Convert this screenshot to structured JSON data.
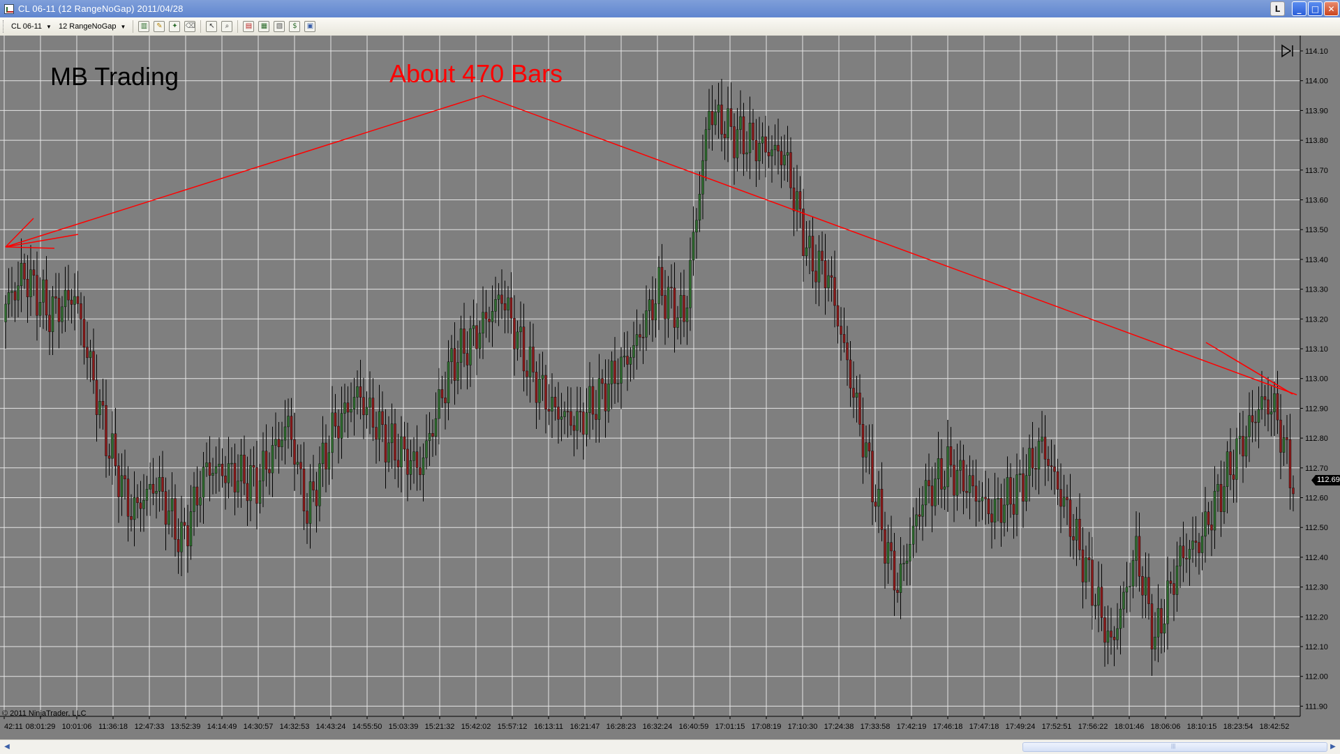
{
  "window": {
    "title": "CL 06-11 (12 RangeNoGap)   2011/04/28",
    "buttons": {
      "lock": "L",
      "minimize": "_",
      "maximize": "□",
      "close": "✕"
    }
  },
  "toolbar": {
    "instrument": "CL 06-11",
    "interval": "12 RangeNoGap",
    "icons": [
      "bar-type-icon",
      "drawing-pencil-icon",
      "draw-object-icon",
      "eraser-icon",
      "cursor-icon",
      "zoom-icon",
      "data-series-icon",
      "indicators-icon",
      "strategies-icon",
      "snapshot-icon",
      "properties-icon"
    ]
  },
  "chart": {
    "broker_label": "MB Trading",
    "annotation": "About 470 Bars",
    "copyright": "© 2011 NinjaTrader, LLC",
    "last_price": "112.69",
    "colors": {
      "background": "#7f7f7f",
      "grid": "#e6e6e6",
      "up_bar": "#2e6b2e",
      "down_bar": "#8b1a1a",
      "wick": "#000000",
      "annotation": "#ff0000"
    }
  },
  "chart_data": {
    "type": "candlestick",
    "title": "",
    "xlabel": "",
    "ylabel": "",
    "ylim": [
      111.9,
      114.1
    ],
    "y_ticks": [
      "114.10",
      "114.00",
      "113.90",
      "113.80",
      "113.70",
      "113.60",
      "113.50",
      "113.40",
      "113.30",
      "113.20",
      "113.10",
      "113.00",
      "112.90",
      "112.80",
      "112.70",
      "112.60",
      "112.50",
      "112.40",
      "112.30",
      "112.20",
      "112.10",
      "112.00",
      "111.90"
    ],
    "x_tick_labels": [
      "42:11",
      "08:01:29",
      "10:01:06",
      "11:36:18",
      "12:47:33",
      "13:52:39",
      "14:14:49",
      "14:30:57",
      "14:32:53",
      "14:43:24",
      "14:55:50",
      "15:03:39",
      "15:21:32",
      "15:42:02",
      "15:57:12",
      "16:13:11",
      "16:21:47",
      "16:28:23",
      "16:32:24",
      "16:40:59",
      "17:01:15",
      "17:08:19",
      "17:10:30",
      "17:24:38",
      "17:33:58",
      "17:42:19",
      "17:46:18",
      "17:47:18",
      "17:49:24",
      "17:52:51",
      "17:56:22",
      "18:01:46",
      "18:06:06",
      "18:10:15",
      "18:23:54",
      "18:42:52"
    ],
    "price_path": [
      [
        0,
        113.25
      ],
      [
        6,
        113.35
      ],
      [
        14,
        113.22
      ],
      [
        22,
        113.28
      ],
      [
        32,
        112.8
      ],
      [
        40,
        112.55
      ],
      [
        48,
        112.65
      ],
      [
        56,
        112.45
      ],
      [
        64,
        112.7
      ],
      [
        72,
        112.68
      ],
      [
        80,
        112.65
      ],
      [
        90,
        112.85
      ],
      [
        96,
        112.55
      ],
      [
        104,
        112.82
      ],
      [
        112,
        112.95
      ],
      [
        122,
        112.78
      ],
      [
        132,
        112.7
      ],
      [
        142,
        113.05
      ],
      [
        150,
        113.15
      ],
      [
        158,
        113.28
      ],
      [
        166,
        113.05
      ],
      [
        174,
        112.9
      ],
      [
        182,
        112.85
      ],
      [
        190,
        112.95
      ],
      [
        200,
        113.1
      ],
      [
        208,
        113.3
      ],
      [
        216,
        113.2
      ],
      [
        224,
        113.9
      ],
      [
        232,
        113.82
      ],
      [
        240,
        113.78
      ],
      [
        248,
        113.75
      ],
      [
        256,
        113.4
      ],
      [
        262,
        113.35
      ],
      [
        268,
        113.05
      ],
      [
        274,
        112.75
      ],
      [
        280,
        112.45
      ],
      [
        284,
        112.3
      ],
      [
        292,
        112.6
      ],
      [
        300,
        112.7
      ],
      [
        306,
        112.65
      ],
      [
        314,
        112.55
      ],
      [
        322,
        112.62
      ],
      [
        330,
        112.78
      ],
      [
        338,
        112.55
      ],
      [
        346,
        112.3
      ],
      [
        352,
        112.1
      ],
      [
        360,
        112.42
      ],
      [
        366,
        112.12
      ],
      [
        374,
        112.4
      ],
      [
        380,
        112.45
      ],
      [
        386,
        112.6
      ],
      [
        392,
        112.75
      ],
      [
        400,
        112.92
      ],
      [
        404,
        112.9
      ],
      [
        410,
        112.65
      ]
    ]
  }
}
